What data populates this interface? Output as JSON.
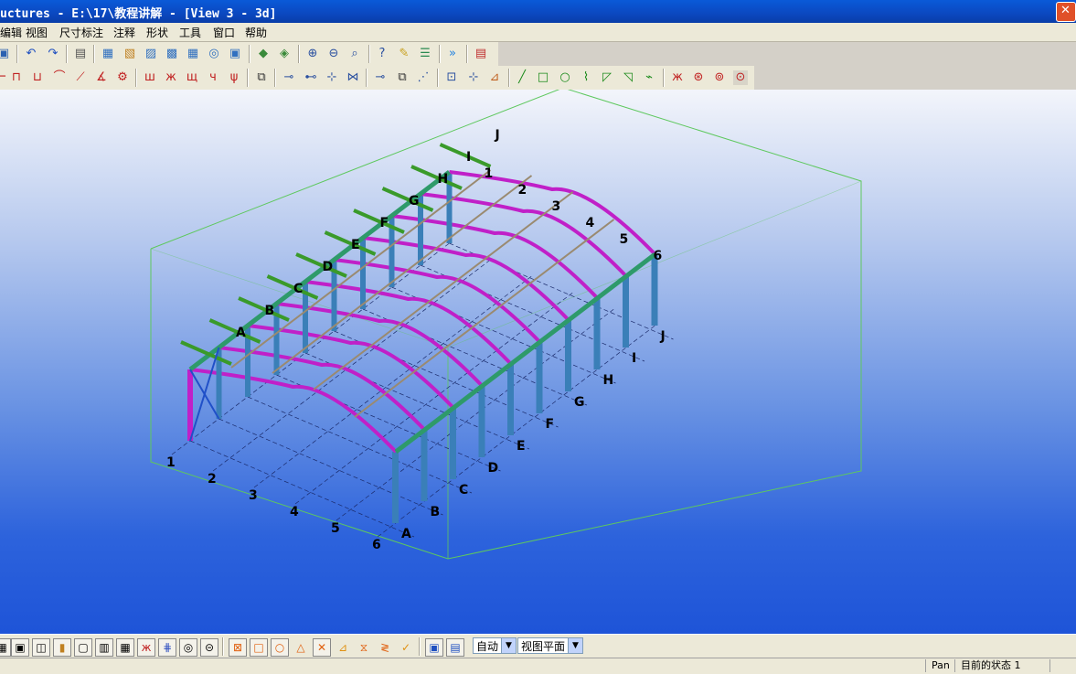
{
  "window": {
    "title": "uctures - E:\\17\\教程讲解 - [View 3 - 3d]"
  },
  "menu": {
    "items": [
      "编辑",
      "视图",
      "尺寸标注",
      "注释",
      "形状",
      "工具",
      "窗口",
      "帮助"
    ]
  },
  "toolbar1": {
    "icons": [
      "save-icon",
      "undo-icon",
      "redo-icon",
      "property-icon",
      "view-icon-1",
      "view-icon-2",
      "view-icon-3",
      "view-icon-4",
      "view-icon-5",
      "view-icon-6",
      "view-icon-7",
      "model-icon-1",
      "model-icon-2",
      "zoom-in-icon",
      "zoom-out-icon",
      "zoom-window-icon",
      "help-icon",
      "macro-icon",
      "list-icon",
      "fast-forward-icon",
      "report-icon"
    ]
  },
  "toolbar2": {
    "icons": [
      "beam-icon",
      "column-icon",
      "frame-icon",
      "arc-icon",
      "brace-icon",
      "angle-icon",
      "connect-icon",
      "stiffener-icon-1",
      "stiffener-icon-2",
      "stiffener-icon-3",
      "stiffener-icon-4",
      "stiffener-icon-5",
      "copy-icon",
      "weld-icon-1",
      "weld-icon-2",
      "weld-icon-3",
      "weld-icon-4",
      "weld-icon-5",
      "weld-icon-6",
      "plate-icon",
      "coordinate-icon",
      "cut-icon",
      "line-icon",
      "rectangle-icon",
      "circle-icon",
      "polyline-icon",
      "chamfer-icon-1",
      "chamfer-icon-2",
      "chamfer-icon-3",
      "select-icon-1",
      "select-icon-2",
      "select-icon-3",
      "select-icon-4"
    ]
  },
  "model": {
    "grid_letters": [
      "A",
      "B",
      "C",
      "D",
      "E",
      "F",
      "G",
      "H",
      "I",
      "J"
    ],
    "grid_numbers": [
      "1",
      "2",
      "3",
      "4",
      "5",
      "6"
    ]
  },
  "bottom_toolbar": {
    "select_auto": "自动",
    "select_plane": "视图平面"
  },
  "status": {
    "mode": "Pan",
    "state": "目前的状态 1"
  },
  "colors": {
    "column": "#3a7fb8",
    "rafter": "#c020c8",
    "purlin": "#9a8a70",
    "tie": "#2e9a6a",
    "bracing_green": "#3a9a2a",
    "bbox": "#5ec85e",
    "grid": "#1a2a6a"
  }
}
